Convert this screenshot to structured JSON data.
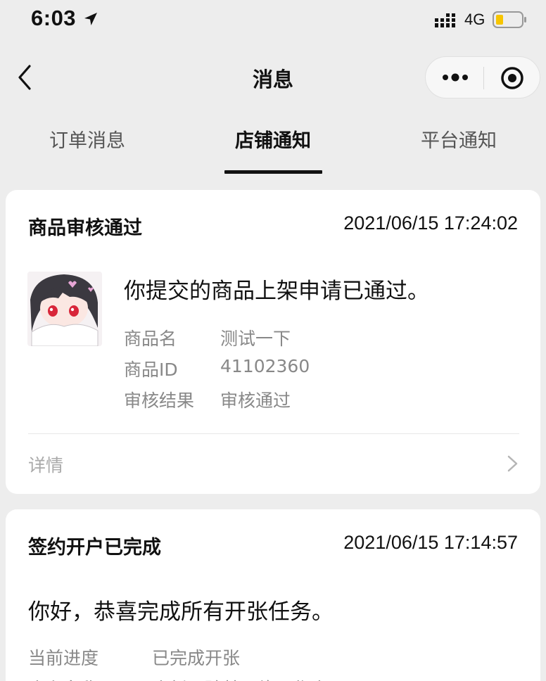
{
  "status_bar": {
    "time": "6:03",
    "network": "4G",
    "icons": [
      "location-arrow-icon",
      "signal-icon",
      "battery-icon"
    ]
  },
  "nav": {
    "title": "消息",
    "back_icon": "chevron-left-icon",
    "capsule_icons": [
      "more-dots-icon",
      "target-icon"
    ]
  },
  "tabs": [
    {
      "label": "订单消息",
      "active": false
    },
    {
      "label": "店铺通知",
      "active": true
    },
    {
      "label": "平台通知",
      "active": false
    }
  ],
  "cards": [
    {
      "title": "商品审核通过",
      "time": "2021/06/15 17:24:02",
      "message": "你提交的商品上架申请已通过。",
      "fields": [
        {
          "label": "商品名",
          "value": "测试一下"
        },
        {
          "label": "商品ID",
          "value": "41102360"
        },
        {
          "label": "审核结果",
          "value": "审核通过"
        }
      ],
      "detail_label": "详情"
    },
    {
      "title": "签约开户已完成",
      "time": "2021/06/15 17:14:57",
      "message": "你好，恭喜完成所有开张任务。",
      "fields": [
        {
          "label": "当前进度",
          "value": "已完成开张"
        },
        {
          "label": "店主名称",
          "value": "店新区验基四络王作店"
        }
      ]
    }
  ],
  "colors": {
    "background": "#ededed",
    "card": "#ffffff",
    "battery_fill": "#f7c500",
    "muted_text": "#888888"
  }
}
